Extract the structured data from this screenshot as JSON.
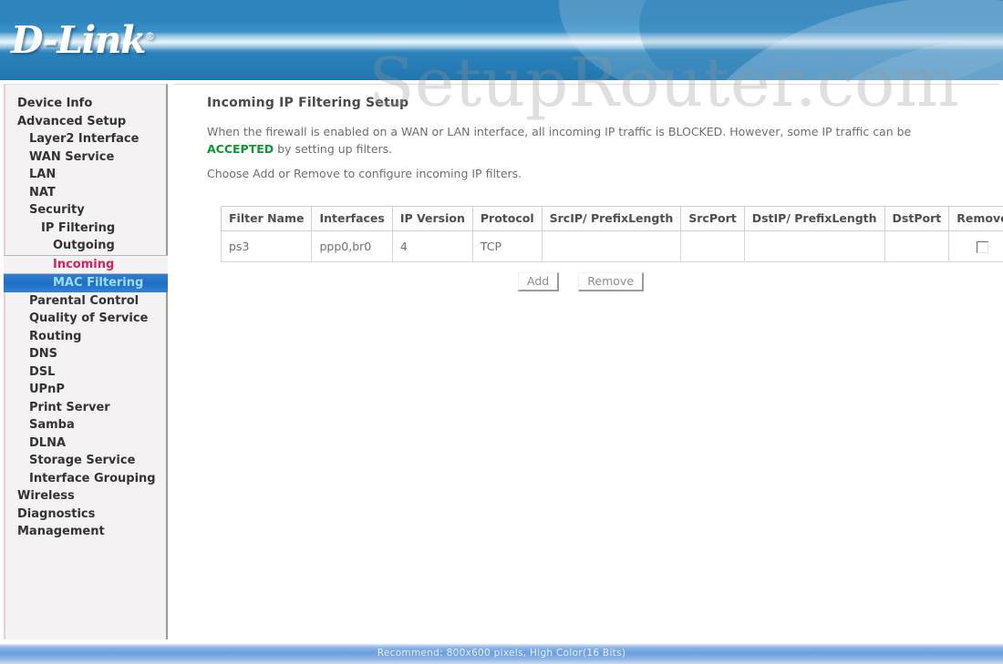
{
  "header": {
    "logo_text": "D-Link",
    "logo_tm": "®"
  },
  "watermark": {
    "text": "SetupRouter.com"
  },
  "sidebar": {
    "items": [
      {
        "label": "Device Info",
        "level": 0,
        "state": "normal"
      },
      {
        "label": "Advanced Setup",
        "level": 0,
        "state": "normal"
      },
      {
        "label": "Layer2 Interface",
        "level": 1,
        "state": "normal"
      },
      {
        "label": "WAN Service",
        "level": 1,
        "state": "normal"
      },
      {
        "label": "LAN",
        "level": 1,
        "state": "normal"
      },
      {
        "label": "NAT",
        "level": 1,
        "state": "normal"
      },
      {
        "label": "Security",
        "level": 1,
        "state": "normal"
      },
      {
        "label": "IP Filtering",
        "level": 2,
        "state": "normal"
      },
      {
        "label": "Outgoing",
        "level": 3,
        "state": "normal"
      },
      {
        "label": "Incoming",
        "level": 3,
        "state": "current"
      },
      {
        "label": "MAC Filtering",
        "level": 3,
        "state": "selected"
      },
      {
        "label": "Parental Control",
        "level": 1,
        "state": "normal"
      },
      {
        "label": "Quality of Service",
        "level": 1,
        "state": "normal"
      },
      {
        "label": "Routing",
        "level": 1,
        "state": "normal"
      },
      {
        "label": "DNS",
        "level": 1,
        "state": "normal"
      },
      {
        "label": "DSL",
        "level": 1,
        "state": "normal"
      },
      {
        "label": "UPnP",
        "level": 1,
        "state": "normal"
      },
      {
        "label": "Print Server",
        "level": 1,
        "state": "normal"
      },
      {
        "label": "Samba",
        "level": 1,
        "state": "normal"
      },
      {
        "label": "DLNA",
        "level": 1,
        "state": "normal"
      },
      {
        "label": "Storage Service",
        "level": 1,
        "state": "normal"
      },
      {
        "label": "Interface Grouping",
        "level": 1,
        "state": "normal"
      },
      {
        "label": "Wireless",
        "level": 0,
        "state": "normal"
      },
      {
        "label": "Diagnostics",
        "level": 0,
        "state": "normal"
      },
      {
        "label": "Management",
        "level": 0,
        "state": "normal"
      }
    ]
  },
  "content": {
    "title": "Incoming IP Filtering Setup",
    "intro_part1": "When the firewall is enabled on a WAN or LAN interface, all incoming IP traffic is BLOCKED. However, some IP traffic can be ",
    "intro_accent": "ACCEPTED",
    "intro_part2": " by setting up filters.",
    "instruction": "Choose Add or Remove to configure incoming IP filters."
  },
  "table": {
    "columns": [
      "Filter Name",
      "Interfaces",
      "IP Version",
      "Protocol",
      "SrcIP/ PrefixLength",
      "SrcPort",
      "DstIP/ PrefixLength",
      "DstPort",
      "Remove"
    ],
    "rows": [
      {
        "filter_name": "ps3",
        "interfaces": "ppp0,br0",
        "ip_version": "4",
        "protocol": "TCP",
        "src_ip_prefix": "",
        "src_port": "",
        "dst_ip_prefix": "",
        "dst_port": "",
        "remove_checked": false
      }
    ]
  },
  "buttons": {
    "add_label": "Add",
    "remove_label": "Remove"
  },
  "footer": {
    "text": "Recommend: 800x600 pixels, High Color(16 Bits)"
  },
  "colors": {
    "header_blue": "#2f84bb",
    "accent_green": "#0a9a2e",
    "current_red": "#d6225c",
    "selected_blue": "#1f6ec4",
    "selected_text": "#9fdcff",
    "footer_blue": "#6b9ede"
  }
}
